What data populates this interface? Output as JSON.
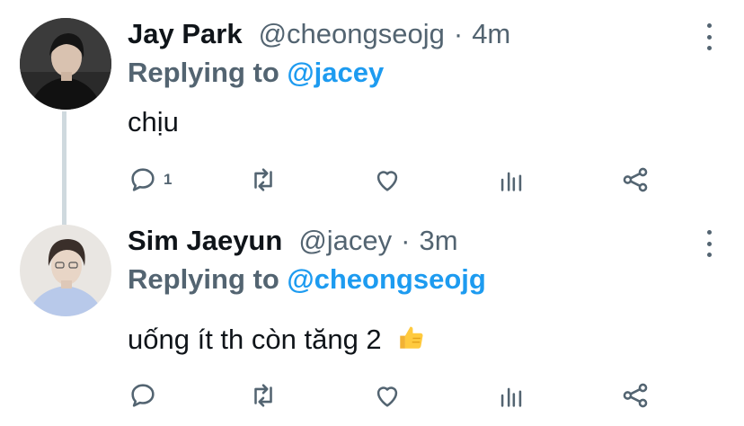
{
  "tweets": [
    {
      "author_name": "Jay Park",
      "handle": "@cheongseojg",
      "separator": "·",
      "time": "4m",
      "replying_label": "Replying to",
      "replying_to": "@jacey",
      "text": "chịu",
      "reply_count": "1",
      "avatar_icon": "avatar-dark-hair-black-shirt"
    },
    {
      "author_name": "Sim Jaeyun",
      "handle": "@jacey",
      "separator": "·",
      "time": "3m",
      "replying_label": "Replying to",
      "replying_to": "@cheongseojg",
      "text": "uống ít th còn tăng 2",
      "reply_count": "",
      "emoji_icon": "thumbs-up-icon",
      "avatar_icon": "avatar-light-blue-shirt"
    }
  ],
  "icons": {
    "reply": "reply-icon",
    "retweet": "retweet-icon",
    "like": "heart-icon",
    "stats": "stats-icon",
    "share": "share-icon",
    "more": "more-options-icon"
  },
  "colors": {
    "text": "#0f1419",
    "secondary": "#536471",
    "accent": "#1d9bf0",
    "thread_line": "#cfd9de"
  }
}
